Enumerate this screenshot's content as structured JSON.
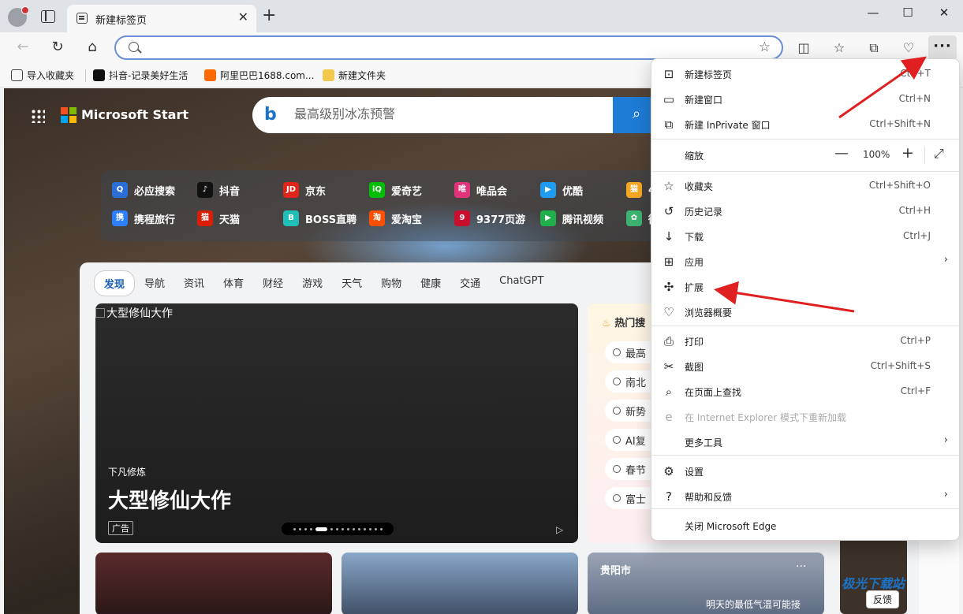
{
  "tab": {
    "title": "新建标签页",
    "close": "✕",
    "new_tab": "+"
  },
  "window": {
    "minimize": "—",
    "maximize": "☐",
    "close": "✕"
  },
  "address": {
    "value": "",
    "placeholder": ""
  },
  "bookmarks": [
    {
      "label": "导入收藏夹",
      "color": "#444444"
    },
    {
      "label": "抖音-记录美好生活",
      "color": "#111111"
    },
    {
      "label": "阿里巴巴1688.com...",
      "color": "#ff6a00"
    },
    {
      "label": "新建文件夹",
      "color": "#f2c94c"
    }
  ],
  "page": {
    "brand": "Microsoft Start",
    "search_placeholder": "最高级别冰冻预警",
    "sites_row1": [
      {
        "label": "必应搜索",
        "color": "#2b6fd6",
        "glyph": "Q"
      },
      {
        "label": "抖音",
        "color": "#111111",
        "glyph": "♪"
      },
      {
        "label": "京东",
        "color": "#e1251b",
        "glyph": "JD"
      },
      {
        "label": "爱奇艺",
        "color": "#00be06",
        "glyph": "iQ"
      },
      {
        "label": "唯品会",
        "color": "#e0337a",
        "glyph": "唯"
      },
      {
        "label": "优酷",
        "color": "#1f9cf0",
        "glyph": "▶"
      },
      {
        "label": "4",
        "color": "#f5a623",
        "glyph": "猫"
      }
    ],
    "sites_row2": [
      {
        "label": "携程旅行",
        "color": "#2d7ff9",
        "glyph": "携"
      },
      {
        "label": "天猫",
        "color": "#d81e06",
        "glyph": "猫"
      },
      {
        "label": "BOSS直聘",
        "color": "#1fbfb8",
        "glyph": "B"
      },
      {
        "label": "爱淘宝",
        "color": "#ff5000",
        "glyph": "淘"
      },
      {
        "label": "9377页游",
        "color": "#c8102e",
        "glyph": "9"
      },
      {
        "label": "腾讯视频",
        "color": "#20b04b",
        "glyph": "▶"
      },
      {
        "label": "微",
        "color": "#3cb371",
        "glyph": "✿"
      }
    ],
    "categories": [
      "发现",
      "导航",
      "资讯",
      "体育",
      "财经",
      "游戏",
      "天气",
      "购物",
      "健康",
      "交通",
      "ChatGPT"
    ],
    "hero": {
      "alt": "大型修仙大作",
      "subtitle": "下凡修炼",
      "title": "大型修仙大作",
      "ad": "广告"
    },
    "hot": {
      "header": "热门搜",
      "items": [
        "最高",
        "南北",
        "新势",
        "AI复",
        "春节",
        "富士"
      ]
    },
    "weather": {
      "city": "贵阳市",
      "more": "···",
      "text": "明天的最低气温可能接"
    },
    "feedback": "反馈",
    "watermark": "极光下载站"
  },
  "menu": {
    "items": [
      {
        "label": "新建标签页",
        "shortcut": "Ctrl+T",
        "icon": "⊡"
      },
      {
        "label": "新建窗口",
        "shortcut": "Ctrl+N",
        "icon": "▭"
      },
      {
        "label": "新建 InPrivate 窗口",
        "shortcut": "Ctrl+Shift+N",
        "icon": "⧉"
      }
    ],
    "zoom": {
      "label": "缩放",
      "minus": "—",
      "value": "100%",
      "plus": "+",
      "full": "⤢"
    },
    "items2": [
      {
        "label": "收藏夹",
        "shortcut": "Ctrl+Shift+O",
        "icon": "☆"
      },
      {
        "label": "历史记录",
        "shortcut": "Ctrl+H",
        "icon": "↺"
      },
      {
        "label": "下载",
        "shortcut": "Ctrl+J",
        "icon": "↓"
      },
      {
        "label": "应用",
        "shortcut": "",
        "icon": "⊞",
        "arrow": "›"
      },
      {
        "label": "扩展",
        "shortcut": "",
        "icon": "✣"
      },
      {
        "label": "浏览器概要",
        "shortcut": "",
        "icon": "♡"
      }
    ],
    "items3": [
      {
        "label": "打印",
        "shortcut": "Ctrl+P",
        "icon": "⎙"
      },
      {
        "label": "截图",
        "shortcut": "Ctrl+Shift+S",
        "icon": "✂"
      },
      {
        "label": "在页面上查找",
        "shortcut": "Ctrl+F",
        "icon": "⌕"
      },
      {
        "label": "在 Internet Explorer 模式下重新加载",
        "shortcut": "",
        "icon": "e"
      },
      {
        "label": "更多工具",
        "shortcut": "",
        "icon": "",
        "arrow": "›"
      }
    ],
    "items4": [
      {
        "label": "设置",
        "shortcut": "",
        "icon": "⚙"
      },
      {
        "label": "帮助和反馈",
        "shortcut": "",
        "icon": "?",
        "arrow": "›"
      }
    ],
    "close_label": "关闭 Microsoft Edge"
  },
  "toolbar": {
    "more": "···"
  }
}
